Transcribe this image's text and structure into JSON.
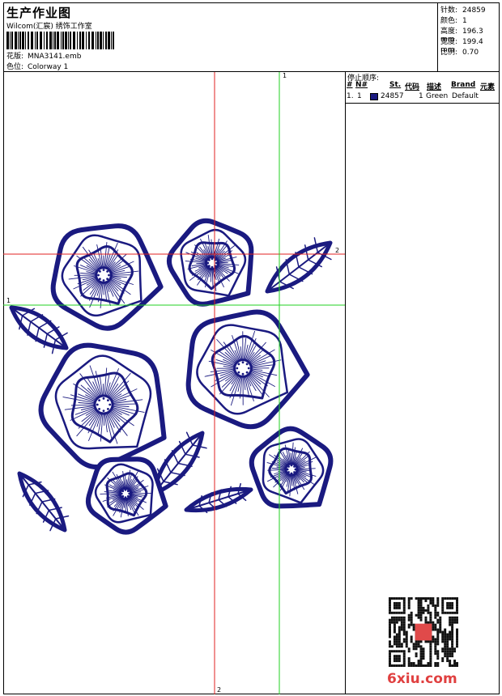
{
  "header": {
    "title": "生产作业图",
    "studio": "Wilcom(汇宸) 绣饰工作室",
    "design_label": "花版:",
    "design_file": "MNA3141.emb",
    "colorway_label": "色位:",
    "colorway": "Colorway 1"
  },
  "specs": [
    {
      "label": "针数:",
      "value": "24859"
    },
    {
      "label": "颜色:",
      "value": "1"
    },
    {
      "label": "高度:",
      "value": "196.3 mm"
    },
    {
      "label": "宽度:",
      "value": "199.4 mm"
    },
    {
      "label": "比例:",
      "value": "0.70"
    }
  ],
  "stop_sequence": {
    "title": "停止顺序:",
    "headers": {
      "num": "#",
      "no": "N#",
      "st": "St.",
      "code": "代码",
      "desc": "描述",
      "brand": "Brand",
      "elem": "元素"
    },
    "rows": [
      {
        "num": "1.",
        "no": "1",
        "st": "24857",
        "code": "1",
        "desc": "Green",
        "brand": "Default",
        "color": "#1a1a80"
      }
    ]
  },
  "guides": {
    "v1": "1",
    "h1": "1",
    "v2": "2",
    "h2": "2"
  },
  "colors": {
    "thread": "#1a1a80",
    "guide_red": "#e02020",
    "guide_green": "#20d020"
  },
  "watermark": "6xiu.com"
}
